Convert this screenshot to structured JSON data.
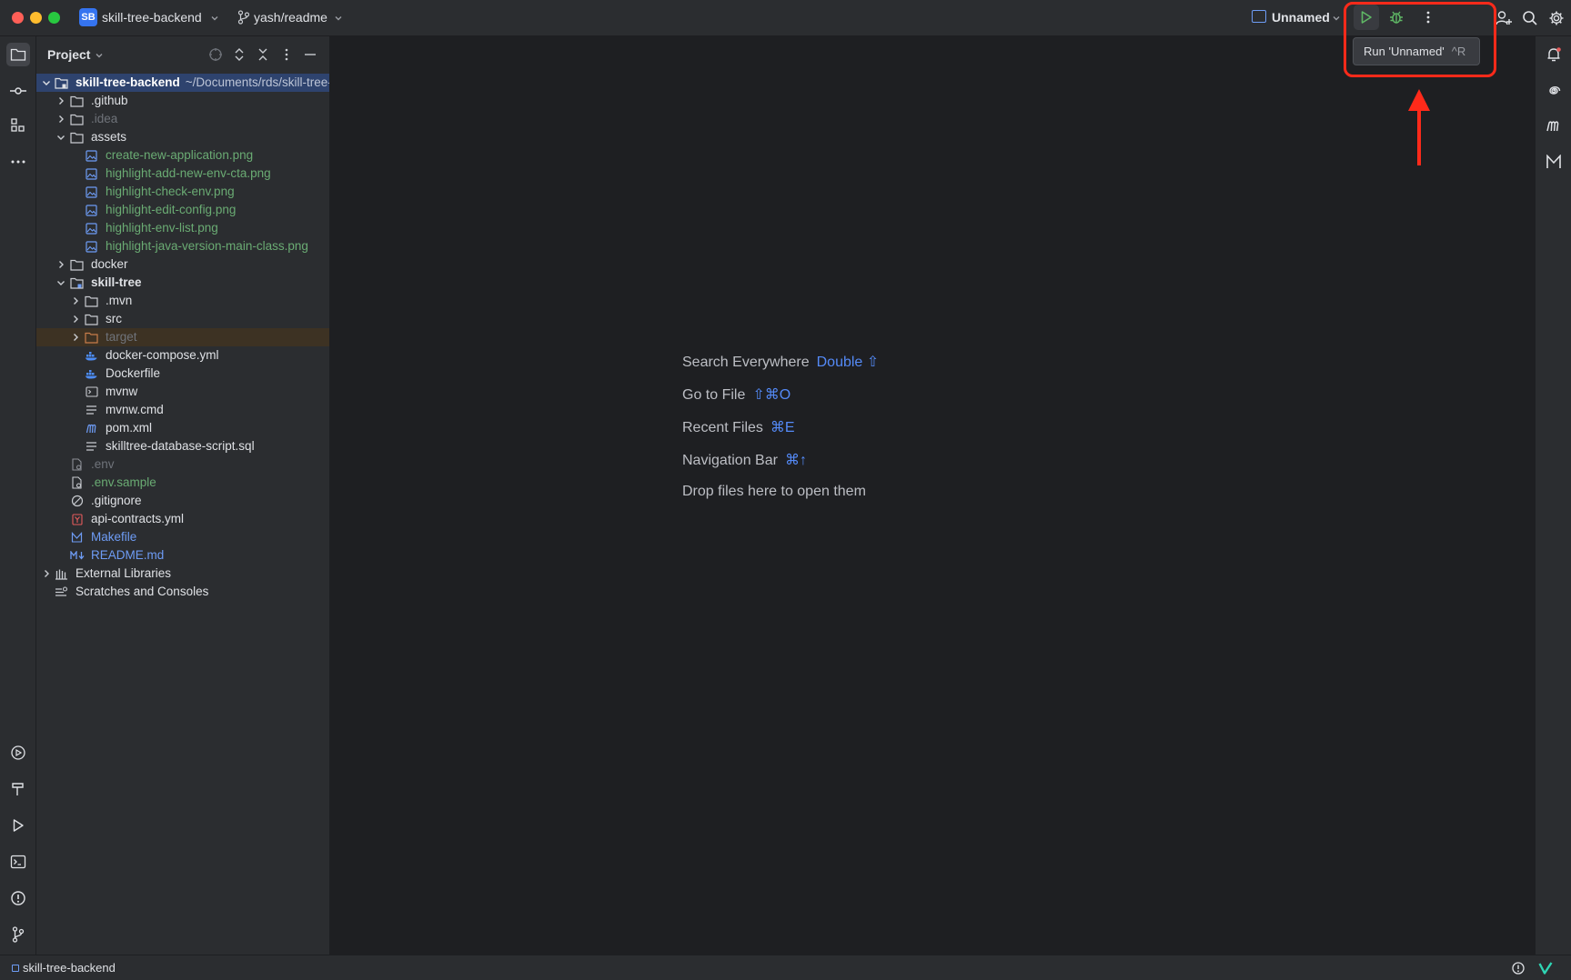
{
  "titlebar": {
    "project_badge": "SB",
    "project_name": "skill-tree-backend",
    "branch": "yash/readme",
    "run_config": "Unnamed"
  },
  "tooltip": {
    "text": "Run 'Unnamed'",
    "shortcut": "^R"
  },
  "project_panel": {
    "title": "Project"
  },
  "tree": {
    "root_label": "skill-tree-backend",
    "root_path": "~/Documents/rds/skill-tree-backend",
    "items": [
      {
        "label": ".github"
      },
      {
        "label": ".idea"
      },
      {
        "label": "assets"
      },
      {
        "label": "create-new-application.png"
      },
      {
        "label": "highlight-add-new-env-cta.png"
      },
      {
        "label": "highlight-check-env.png"
      },
      {
        "label": "highlight-edit-config.png"
      },
      {
        "label": "highlight-env-list.png"
      },
      {
        "label": "highlight-java-version-main-class.png"
      },
      {
        "label": "docker"
      },
      {
        "label": "skill-tree"
      },
      {
        "label": ".mvn"
      },
      {
        "label": "src"
      },
      {
        "label": "target"
      },
      {
        "label": "docker-compose.yml"
      },
      {
        "label": "Dockerfile"
      },
      {
        "label": "mvnw"
      },
      {
        "label": "mvnw.cmd"
      },
      {
        "label": "pom.xml"
      },
      {
        "label": "skilltree-database-script.sql"
      },
      {
        "label": ".env"
      },
      {
        "label": ".env.sample"
      },
      {
        "label": ".gitignore"
      },
      {
        "label": "api-contracts.yml"
      },
      {
        "label": "Makefile"
      },
      {
        "label": "README.md"
      },
      {
        "label": "External Libraries"
      },
      {
        "label": "Scratches and Consoles"
      }
    ]
  },
  "editor_hints": [
    {
      "label": "Search Everywhere",
      "shortcut": "Double ⇧"
    },
    {
      "label": "Go to File",
      "shortcut": "⇧⌘O"
    },
    {
      "label": "Recent Files",
      "shortcut": "⌘E"
    },
    {
      "label": "Navigation Bar",
      "shortcut": "⌘↑"
    },
    {
      "label": "Drop files here to open them",
      "shortcut": ""
    }
  ],
  "statusbar": {
    "project": "skill-tree-backend"
  },
  "colors": {
    "accent": "#3574f0",
    "annotation": "#ff2a1a",
    "run_green": "#5fb865"
  }
}
